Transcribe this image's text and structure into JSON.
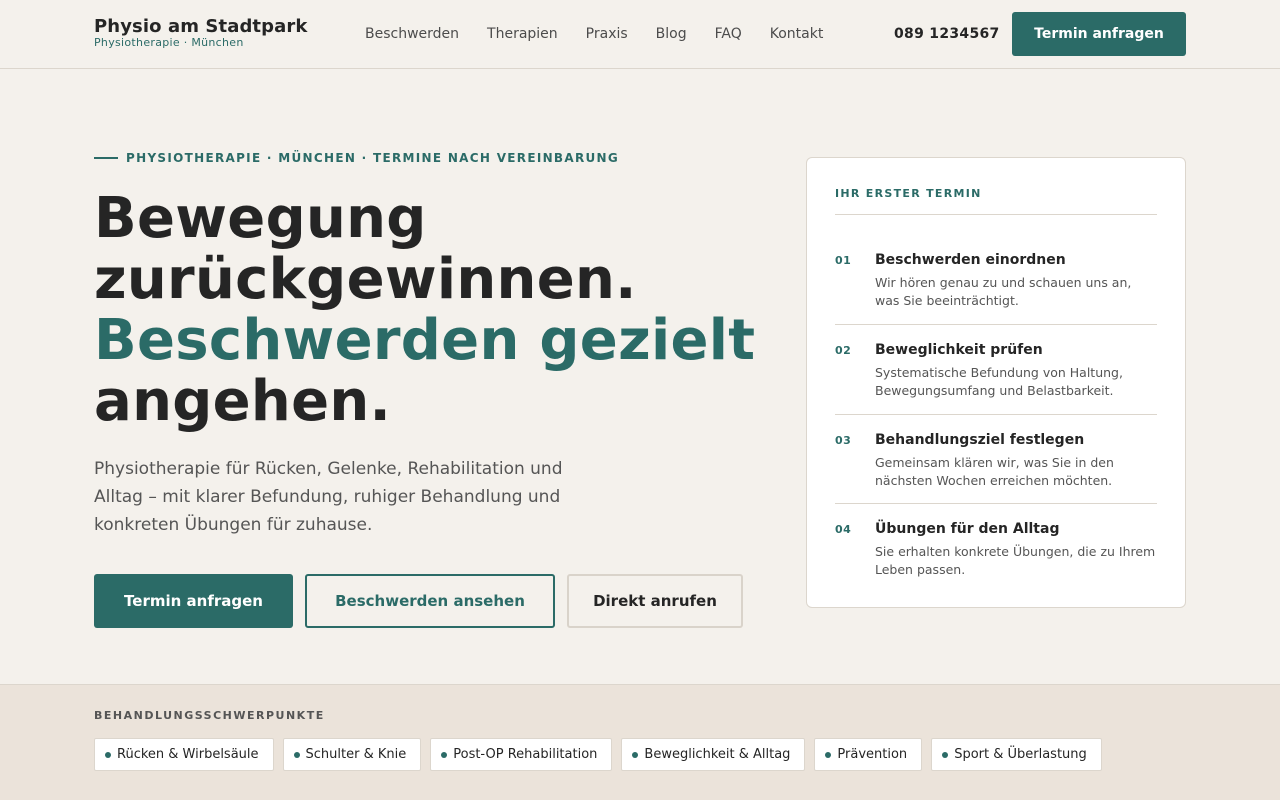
{
  "header": {
    "brand_name": "Physio am Stadtpark",
    "brand_sub": "Physiotherapie · München",
    "nav": [
      "Beschwerden",
      "Therapien",
      "Praxis",
      "Blog",
      "FAQ",
      "Kontakt"
    ],
    "phone": "089 1234567",
    "cta_label": "Termin anfragen"
  },
  "hero": {
    "eyebrow": "PHYSIOTHERAPIE · MÜNCHEN · TERMINE NACH VEREINBARUNG",
    "headline_line1": "Bewegung",
    "headline_line2": "zurückgewinnen.",
    "headline_accent": "Beschwerden gezielt",
    "headline_line4": "angehen.",
    "lead": "Physiotherapie für Rücken, Gelenke, Rehabilitation und Alltag – mit klarer Befundung, ruhiger Behandlung und konkreten Übungen für zuhause.",
    "buttons": {
      "primary": "Termin anfragen",
      "secondary": "Beschwerden ansehen",
      "tertiary": "Direkt anrufen"
    }
  },
  "card": {
    "title": "IHR ERSTER TERMIN",
    "steps": [
      {
        "num": "01",
        "title": "Beschwerden einordnen",
        "desc": "Wir hören genau zu und schauen uns an, was Sie beeinträchtigt."
      },
      {
        "num": "02",
        "title": "Beweglichkeit prüfen",
        "desc": "Systematische Befundung von Haltung, Bewegungsumfang und Belastbarkeit."
      },
      {
        "num": "03",
        "title": "Behandlungsziel festlegen",
        "desc": "Gemeinsam klären wir, was Sie in den nächsten Wochen erreichen möchten."
      },
      {
        "num": "04",
        "title": "Übungen für den Alltag",
        "desc": "Sie erhalten konkrete Übungen, die zu Ihrem Leben passen."
      }
    ]
  },
  "focus": {
    "title": "BEHANDLUNGSSCHWERPUNKTE",
    "chips": [
      "Rücken & Wirbelsäule",
      "Schulter & Knie",
      "Post-OP Rehabilitation",
      "Beweglichkeit & Alltag",
      "Prävention",
      "Sport & Überlastung"
    ]
  },
  "colors": {
    "accent": "#2b6b67",
    "background": "#f4f1ec",
    "band": "#ebe3da",
    "text": "#252525"
  }
}
